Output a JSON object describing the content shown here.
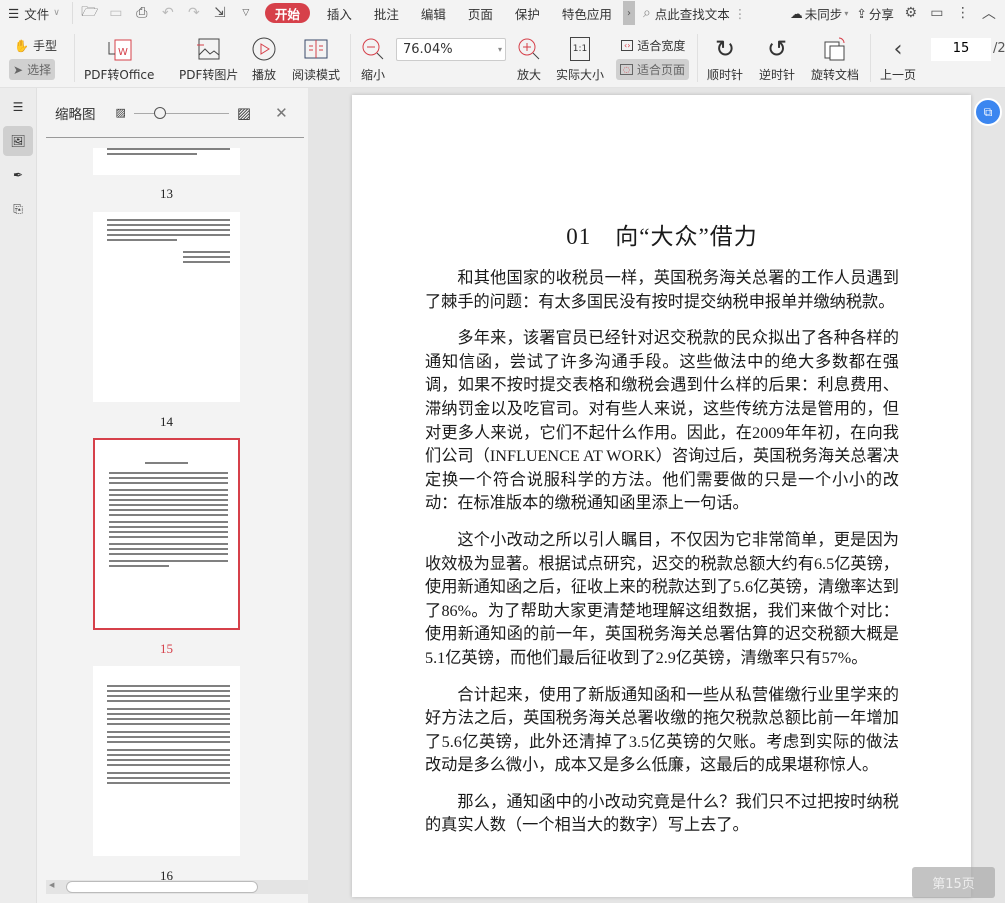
{
  "topbar": {
    "file_menu": "文件",
    "tabs": [
      "开始",
      "插入",
      "批注",
      "编辑",
      "页面",
      "保护",
      "特色应用"
    ],
    "search_placeholder": "点此查找文本",
    "sync": "未同步",
    "share": "分享"
  },
  "toolbar": {
    "hand": "手型",
    "select": "选择",
    "pdf_to_office": "PDF转Office",
    "pdf_to_image": "PDF转图片",
    "play": "播放",
    "read_mode": "阅读模式",
    "zoom_out": "缩小",
    "zoom_value": "76.04%",
    "zoom_in": "放大",
    "actual_size": "实际大小",
    "actual_size_icon_text": "1:1",
    "fit_width": "适合宽度",
    "fit_page": "适合页面",
    "clockwise": "顺时针",
    "counterclockwise": "逆时针",
    "rotate_doc": "旋转文档",
    "prev_page": "上一页",
    "current_page": "15",
    "total_prefix": "/2"
  },
  "thumbnails": {
    "title": "缩略图",
    "pages": [
      "13",
      "14",
      "15",
      "16"
    ],
    "selected": "15",
    "accent": "#d6404a"
  },
  "document": {
    "title": "01　向“大众”借力",
    "paragraphs": [
      "和其他国家的收税员一样，英国税务海关总署的工作人员遇到了棘手的问题：有太多国民没有按时提交纳税申报单并缴纳税款。",
      "多年来，该署官员已经针对迟交税款的民众拟出了各种各样的通知信函，尝试了许多沟通手段。这些做法中的绝大多数都在强调，如果不按时提交表格和缴税会遇到什么样的后果：利息费用、滞纳罚金以及吃官司。对有些人来说，这些传统方法是管用的，但对更多人来说，它们不起什么作用。因此，在2009年年初，在向我们公司（INFLUENCE AT WORK）咨询过后，英国税务海关总署决定换一个符合说服科学的方法。他们需要做的只是一个小小的改动：在标准版本的缴税通知函里添上一句话。",
      "这个小改动之所以引人瞩目，不仅因为它非常简单，更是因为收效极为显著。根据试点研究，迟交的税款总额大约有6.5亿英镑，使用新通知函之后，征收上来的税款达到了5.6亿英镑，清缴率达到了86%。为了帮助大家更清楚地理解这组数据，我们来做个对比：使用新通知函的前一年，英国税务海关总署估算的迟交税额大概是5.1亿英镑，而他们最后征收到了2.9亿英镑，清缴率只有57%。",
      "合计起来，使用了新版通知函和一些从私营催缴行业里学来的好方法之后，英国税务海关总署收缴的拖欠税款总额比前一年增加了5.6亿英镑，此外还清掉了3.5亿英镑的欠账。考虑到实际的做法改动是多么微小，成本又是多么低廉，这最后的成果堪称惊人。",
      "那么，通知函中的小改动究竟是什么？我们只不过把按时纳税的真实人数（一个相当大的数字）写上去了。"
    ]
  },
  "page_badge": "第15页"
}
